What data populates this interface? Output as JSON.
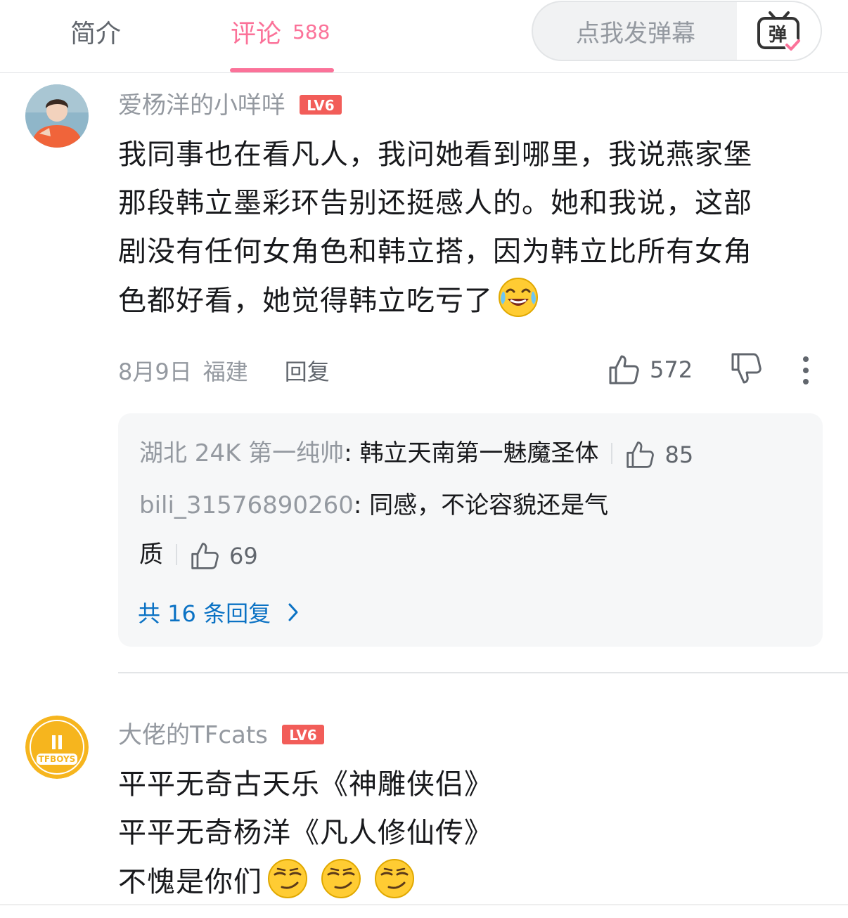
{
  "tabs": {
    "intro_label": "简介",
    "comments_label": "评论",
    "comments_count": "588"
  },
  "danmaku": {
    "placeholder": "点我发弹幕",
    "toggle_text": "弹"
  },
  "colors": {
    "accent": "#fb7299",
    "link": "#0b72c4",
    "level_badge": "#f25d59",
    "text_muted": "#9499a0"
  },
  "comments": [
    {
      "username": "爱杨洋的小咩咩",
      "level": "LV6",
      "content_lines": [
        "我同事也在看凡人，我问她看到哪里，我说燕家堡",
        "那段韩立墨彩环告别还挺感人的。她和我说，这部",
        "剧没有任何女角色和韩立搭，因为韩立比所有女角",
        "色都好看，她觉得韩立吃亏了"
      ],
      "emoji": "tears-of-joy-emoji",
      "date": "8月9日",
      "location": "福建",
      "reply_label": "回复",
      "likes": "572",
      "replies": [
        {
          "user": "湖北 24K 第一纯帅",
          "text": "韩立天南第一魅魔圣体",
          "likes": "85"
        },
        {
          "user": "bili_31576890260",
          "text_line1": "同感，不论容貌还是气",
          "text_line2": "质",
          "likes": "69"
        }
      ],
      "more_replies_label": "共 16 条回复"
    },
    {
      "username": "大佬的TFcats",
      "level": "LV6",
      "avatar_text": "TFBOYS",
      "content_lines": [
        "平平无奇古天乐《神雕侠侣》",
        "平平无奇杨洋《凡人修仙传》",
        "不愧是你们"
      ],
      "emoji": "smirk-emoji"
    }
  ]
}
